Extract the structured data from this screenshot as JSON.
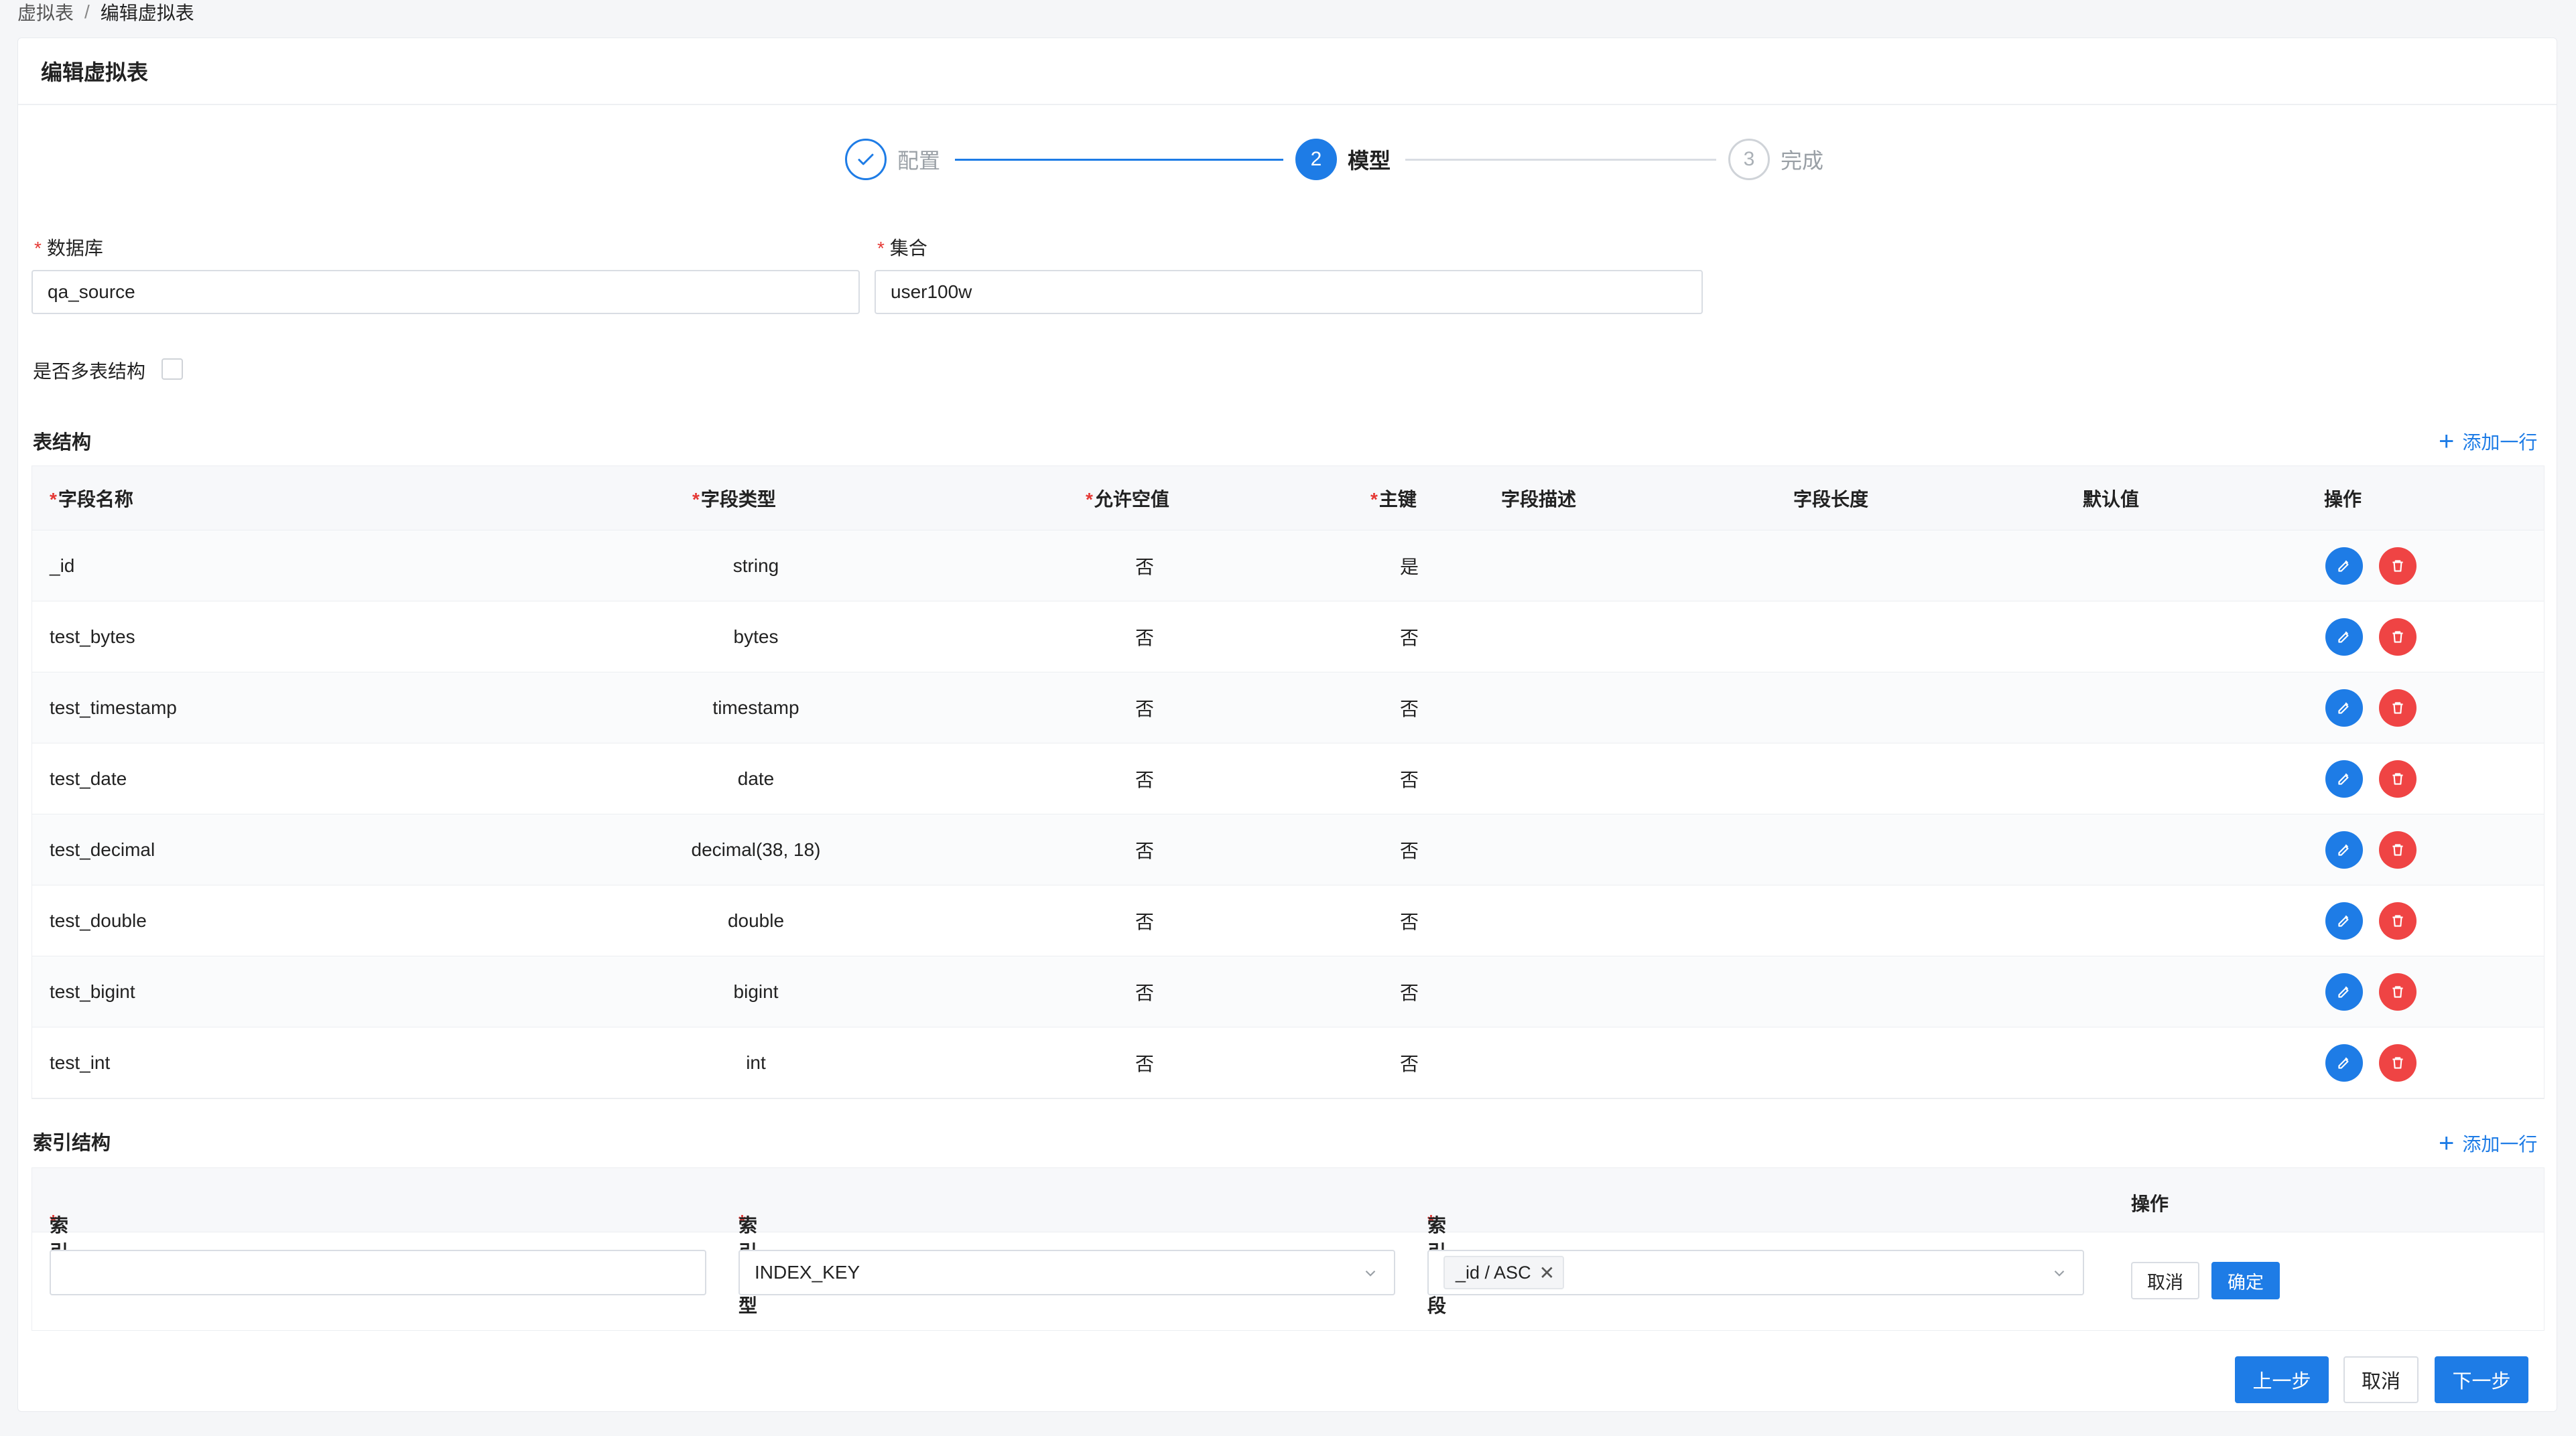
{
  "breadcrumb": {
    "parent": "虚拟表",
    "separator": "/",
    "current": "编辑虚拟表"
  },
  "header": {
    "title": "编辑虚拟表"
  },
  "steps": [
    {
      "number": "1",
      "label": "配置",
      "state": "done"
    },
    {
      "number": "2",
      "label": "模型",
      "state": "active"
    },
    {
      "number": "3",
      "label": "完成",
      "state": "pending"
    }
  ],
  "form": {
    "database_label": "数据库",
    "database_value": "qa_source",
    "collection_label": "集合",
    "collection_value": "user100w",
    "multi_table_label": "是否多表结构",
    "multi_table_checked": false
  },
  "schema": {
    "title": "表结构",
    "add_row": "添加一行",
    "headers": {
      "name": "字段名称",
      "type": "字段类型",
      "nullable": "允许空值",
      "pk": "主键",
      "desc": "字段描述",
      "length": "字段长度",
      "default": "默认值",
      "ops": "操作"
    },
    "rows": [
      {
        "name": "_id",
        "type": "string",
        "nullable": "否",
        "pk": "是"
      },
      {
        "name": "test_bytes",
        "type": "bytes",
        "nullable": "否",
        "pk": "否"
      },
      {
        "name": "test_timestamp",
        "type": "timestamp",
        "nullable": "否",
        "pk": "否"
      },
      {
        "name": "test_date",
        "type": "date",
        "nullable": "否",
        "pk": "否"
      },
      {
        "name": "test_decimal",
        "type": "decimal(38, 18)",
        "nullable": "否",
        "pk": "否"
      },
      {
        "name": "test_double",
        "type": "double",
        "nullable": "否",
        "pk": "否"
      },
      {
        "name": "test_bigint",
        "type": "bigint",
        "nullable": "否",
        "pk": "否"
      },
      {
        "name": "test_int",
        "type": "int",
        "nullable": "否",
        "pk": "否"
      }
    ]
  },
  "index": {
    "title": "索引结构",
    "add_row": "添加一行",
    "headers": {
      "name": "索引",
      "type": "索引类型",
      "fields": "索引字段",
      "ops": "操作"
    },
    "row": {
      "name_value": "",
      "type_value": "INDEX_KEY",
      "field_tag": "_id / ASC",
      "cancel": "取消",
      "confirm": "确定"
    }
  },
  "footer": {
    "prev": "上一步",
    "cancel": "取消",
    "next": "下一步"
  },
  "colors": {
    "primary": "#1e7ce6",
    "danger": "#ef4444",
    "required": "#e53935"
  }
}
